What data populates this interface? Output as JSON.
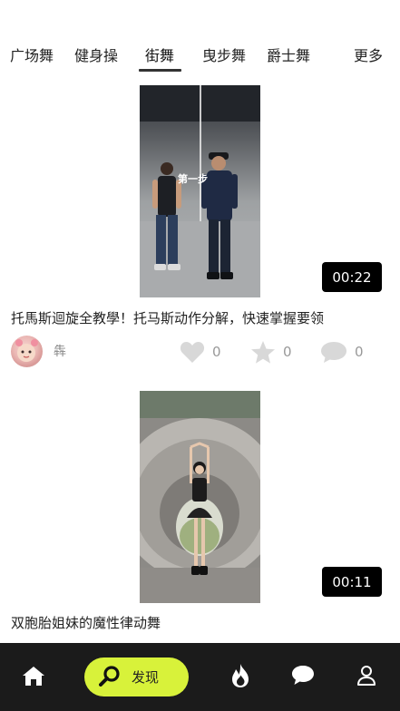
{
  "tabs": [
    {
      "label": "广场舞"
    },
    {
      "label": "健身操"
    },
    {
      "label": "街舞"
    },
    {
      "label": "曳步舞"
    },
    {
      "label": "爵士舞"
    },
    {
      "label": "更多"
    }
  ],
  "active_tab": "街舞",
  "videos": [
    {
      "duration": "00:22",
      "thumb_caption": "第一步",
      "title": "托馬斯迴旋全教學！托马斯动作分解，快速掌握要领",
      "author": "犇",
      "likes": "0",
      "favorites": "0",
      "comments": "0"
    },
    {
      "duration": "00:11",
      "title": "双胞胎姐妹的魔性律动舞"
    }
  ],
  "bottom_nav": {
    "discover_label": "发现"
  },
  "colors": {
    "accent": "#d8f23a",
    "nav_bg": "#1b1b1b",
    "duration_bg": "#000000"
  }
}
